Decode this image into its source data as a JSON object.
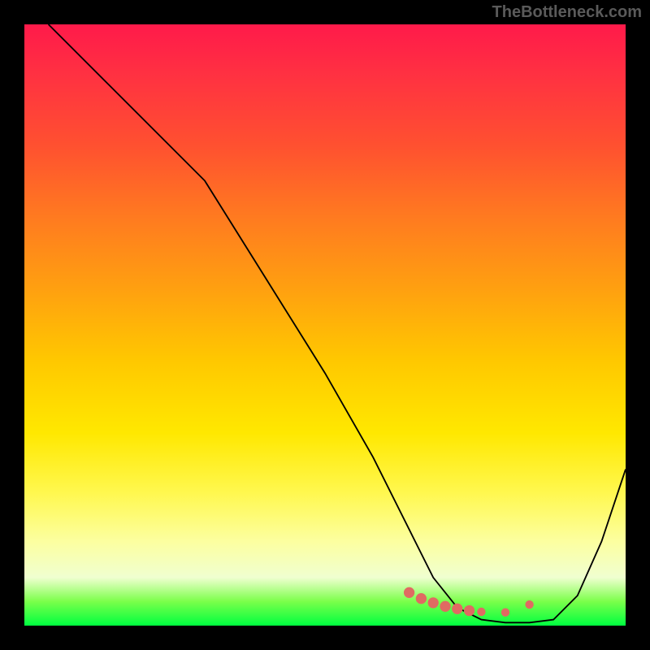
{
  "watermark": "TheBottleneck.com",
  "chart_data": {
    "type": "line",
    "title": "",
    "xlabel": "",
    "ylabel": "",
    "xlim": [
      0,
      100
    ],
    "ylim": [
      0,
      100
    ],
    "series": [
      {
        "name": "curve",
        "x": [
          4,
          14,
          24,
          30,
          40,
          50,
          58,
          64,
          68,
          72,
          76,
          80,
          84,
          88,
          92,
          96,
          100
        ],
        "y": [
          100,
          90,
          80,
          74,
          58,
          42,
          28,
          16,
          8,
          3,
          1,
          0.5,
          0.5,
          1,
          5,
          14,
          26
        ]
      }
    ],
    "markers": [
      {
        "name": "dots",
        "x": [
          64,
          66,
          68,
          70,
          72,
          74,
          76,
          80,
          84
        ],
        "y": [
          5.5,
          4.5,
          3.8,
          3.2,
          2.8,
          2.5,
          2.3,
          2.2,
          3.5
        ]
      }
    ],
    "gradient_stops": [
      {
        "pos": 0,
        "color": "#ff1a4a"
      },
      {
        "pos": 50,
        "color": "#ffc800"
      },
      {
        "pos": 95,
        "color": "#f0ffd0"
      },
      {
        "pos": 100,
        "color": "#00ff40"
      }
    ]
  }
}
